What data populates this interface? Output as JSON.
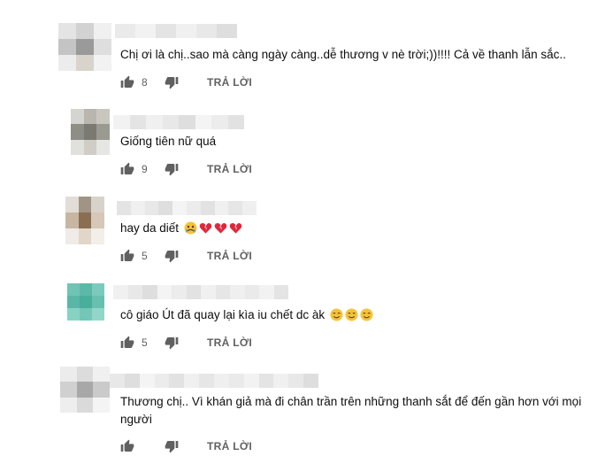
{
  "comments": [
    {
      "text": "Chị ơi là chị..sao mà càng ngày càng..dễ thương v nè trời;))!!!! Cả về thanh lẫn sắc..",
      "likes": "8",
      "reply_label": "TRẢ LỜI",
      "avatar_colors": [
        "#e4e4e4",
        "#d2d2d2",
        "#f0f0f0",
        "#c4c4c4",
        "#9a9a9a",
        "#dedede",
        "#ececec",
        "#d8d4cc",
        "#f2f2f2"
      ],
      "emojis": []
    },
    {
      "text": "Giống tiên nữ quá",
      "likes": "9",
      "reply_label": "TRẢ LỜI",
      "avatar_colors": [
        "#d4d4d0",
        "#b8b6ae",
        "#c8c6be",
        "#8e8e86",
        "#7a7a72",
        "#9a9a92",
        "#e0e0dc",
        "#cfcdc6",
        "#e6e6e2"
      ],
      "emojis": []
    },
    {
      "text": "hay da diết",
      "likes": "5",
      "reply_label": "TRẢ LỜI",
      "avatar_colors": [
        "#e2ddd6",
        "#a09484",
        "#d8d2ca",
        "#c8b6a2",
        "#8a6e52",
        "#d6c8b8",
        "#efebe6",
        "#e2d6c8",
        "#f2eee8"
      ],
      "emojis": [
        "crying-emoji",
        "broken-heart-emoji",
        "broken-heart-emoji",
        "broken-heart-emoji"
      ]
    },
    {
      "text": "cô giáo Út đã quay lại kìa iu chết dc àk",
      "likes": "5",
      "reply_label": "TRẢ LỜI",
      "avatar_colors": [
        "#6fc4b4",
        "#5cb8a8",
        "#7ccabc",
        "#5ab6a6",
        "#4aae9c",
        "#68c0b0",
        "#88d2c4",
        "#74c6b8",
        "#92d6ca"
      ],
      "emojis": [
        "smile-emoji",
        "smile-emoji",
        "smile-emoji"
      ]
    },
    {
      "text": "Thương chị.. Vì khán giả mà đi chân trần trên những thanh sắt để đến gần hơn với mọi người",
      "likes": "",
      "reply_label": "TRẢ LỜI",
      "avatar_colors": [
        "#ececec",
        "#dcdcdc",
        "#f0f0f0",
        "#d0d0d0",
        "#a8a8a8",
        "#cacaca",
        "#eeeeee",
        "#dadada",
        "#f4f4f4"
      ],
      "emojis": []
    }
  ],
  "name_bar_colors": [
    "#eaeaea",
    "#f2f2f2",
    "#e4e4e4",
    "#f0f0f0",
    "#e8e8e8",
    "#dedede",
    "#f4f4f4",
    "#ececec",
    "#e2e2e2",
    "#f0f0f0",
    "#e6e6e6",
    "#efefef"
  ]
}
